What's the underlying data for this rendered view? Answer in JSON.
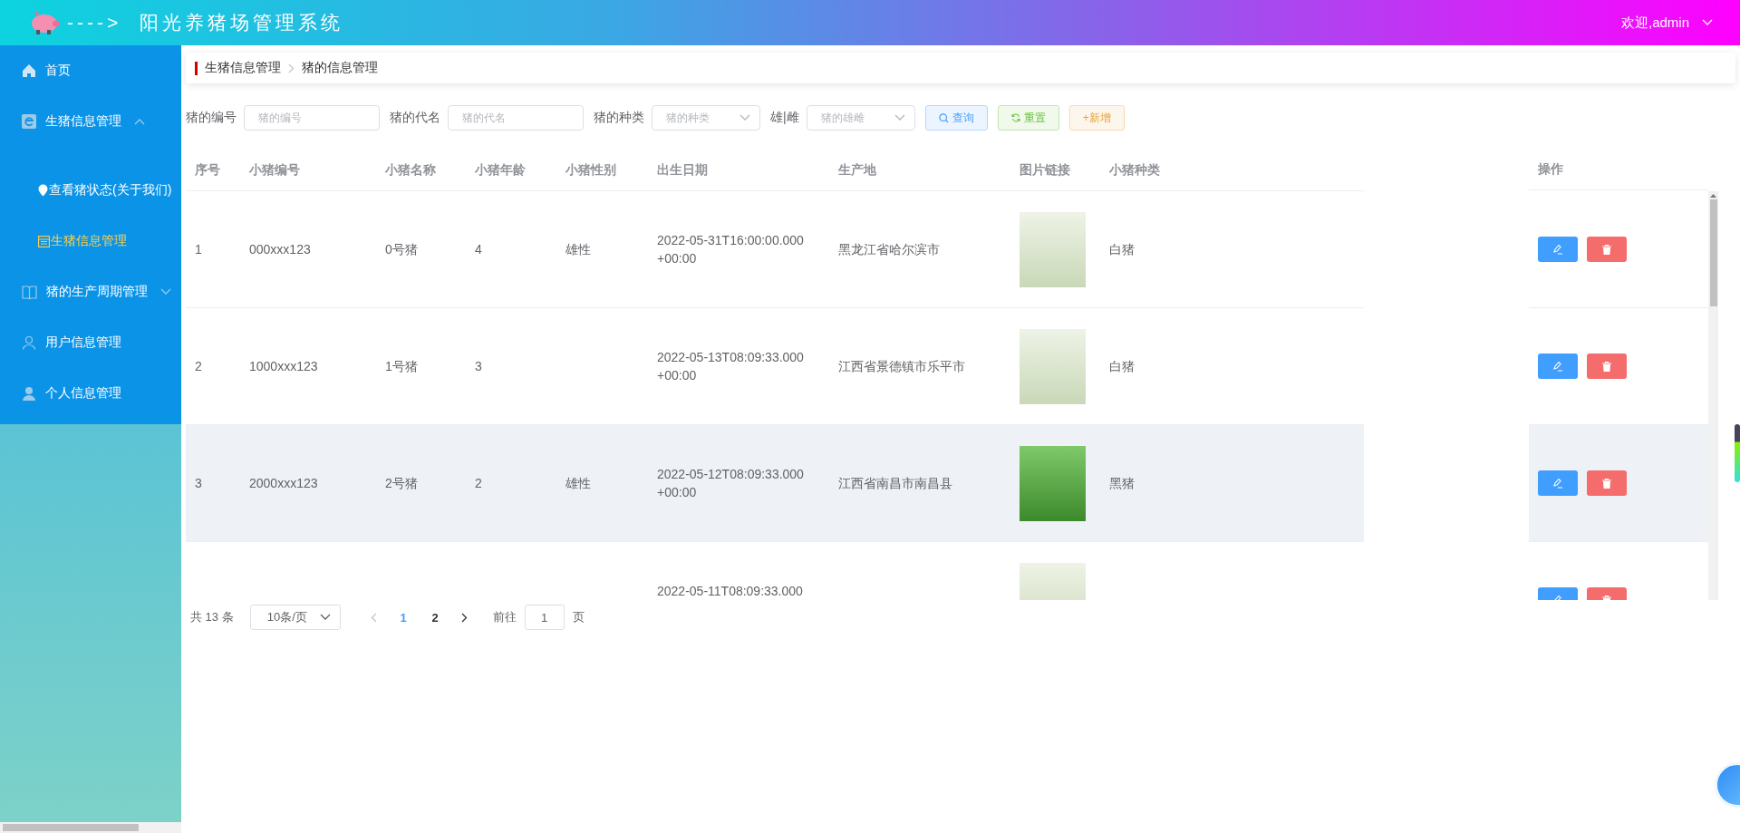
{
  "header": {
    "title": "---->  阳光养猪场管理系统",
    "user": "欢迎,admin"
  },
  "sidebar": {
    "items": [
      {
        "label": "首页",
        "selected": false
      },
      {
        "label": "生猪信息管理",
        "selected": false,
        "expanded": true,
        "children": [
          {
            "label": "查看猪状态(关于我们)",
            "selected": false
          },
          {
            "label": "生猪信息管理",
            "selected": true
          }
        ]
      },
      {
        "label": "猪的生产周期管理",
        "selected": false,
        "expanded": false
      },
      {
        "label": "用户信息管理",
        "selected": false
      },
      {
        "label": "个人信息管理",
        "selected": false
      }
    ]
  },
  "breadcrumb": [
    "生猪信息管理",
    "猪的信息管理"
  ],
  "filters": [
    {
      "label": "猪的编号",
      "placeholder": "猪的编号",
      "kind": "input"
    },
    {
      "label": "猪的代名",
      "placeholder": "猪的代名",
      "kind": "input"
    },
    {
      "label": "猪的种类",
      "placeholder": "猪的种类",
      "kind": "select"
    },
    {
      "label": "雄|雌",
      "placeholder": "猪的雄雌",
      "kind": "select"
    }
  ],
  "buttons": [
    {
      "label": "查询",
      "kind": "search"
    },
    {
      "label": "重置",
      "kind": "reset"
    },
    {
      "label": "+新增",
      "kind": "add"
    }
  ],
  "table": {
    "columns": [
      "序号",
      "小猪编号",
      "小猪名称",
      "小猪年龄",
      "小猪性别",
      "出生日期",
      "生产地",
      "图片链接",
      "小猪种类"
    ],
    "action_column": "操作",
    "rows": [
      {
        "index": "1",
        "code": "000xxx123",
        "name": "0号猪",
        "age": "4",
        "sex": "雄性",
        "birth": [
          "2022-05-31T16:00:00.000",
          "+00:00"
        ],
        "origin": "黑龙江省哈尔滨市",
        "breed": "白猪",
        "highlighted": false
      },
      {
        "index": "2",
        "code": "1000xxx123",
        "name": "1号猪",
        "age": "3",
        "birth": [
          "2022-05-13T08:09:33.000",
          "+00:00"
        ],
        "origin": "江西省景德镇市乐平市",
        "breed": "白猪",
        "highlighted": false
      },
      {
        "index": "3",
        "code": "2000xxx123",
        "name": "2号猪",
        "age": "2",
        "sex": "雄性",
        "birth": [
          "2022-05-12T08:09:33.000",
          "+00:00"
        ],
        "origin": "江西省南昌市南昌县",
        "breed": "黑猪",
        "highlighted": true
      },
      {
        "birth": [
          "2022-05-11T08:09:33.000"
        ],
        "highlighted": false
      }
    ]
  },
  "pagination": {
    "total": "共 13 条",
    "page_size": "10条/页",
    "pages": [
      {
        "label": "1",
        "selected": true
      },
      {
        "label": "2",
        "selected": false
      }
    ],
    "goto_label": "前往",
    "goto_value": "1",
    "goto_suffix": "页"
  }
}
